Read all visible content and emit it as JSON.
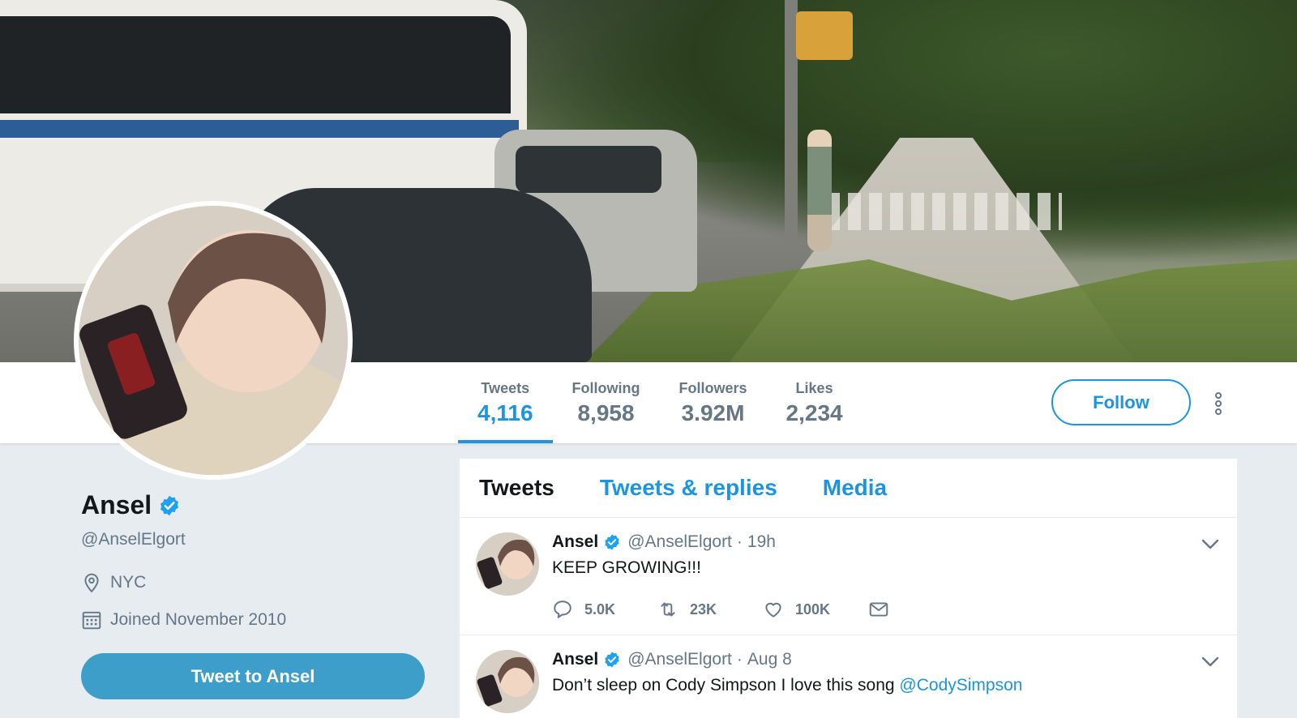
{
  "profile": {
    "name": "Ansel",
    "handle": "@AnselElgort",
    "location": "NYC",
    "joined": "Joined November 2010",
    "tweet_to_label": "Tweet to Ansel",
    "verified": true
  },
  "stats": [
    {
      "label": "Tweets",
      "value": "4,116",
      "active": true
    },
    {
      "label": "Following",
      "value": "8,958",
      "active": false
    },
    {
      "label": "Followers",
      "value": "3.92M",
      "active": false
    },
    {
      "label": "Likes",
      "value": "2,234",
      "active": false
    }
  ],
  "nav": {
    "follow_label": "Follow"
  },
  "timeline": {
    "tabs": [
      {
        "label": "Tweets",
        "active": true
      },
      {
        "label": "Tweets & replies",
        "active": false
      },
      {
        "label": "Media",
        "active": false
      }
    ],
    "tweets": [
      {
        "name": "Ansel",
        "handle": "@AnselElgort",
        "dot": "·",
        "time": "19h",
        "text": "KEEP GROWING!!!",
        "replies": "5.0K",
        "retweets": "23K",
        "likes": "100K"
      },
      {
        "name": "Ansel",
        "handle": "@AnselElgort",
        "dot": "·",
        "time": "Aug 8",
        "text": "Don’t sleep on Cody Simpson I love this song ",
        "mention": "@CodySimpson"
      }
    ]
  },
  "colors": {
    "accent": "#1b95e0",
    "muted": "#657786",
    "background": "#e6ecf0",
    "verified": "#1da1f2"
  },
  "icons": [
    "verified-badge-icon",
    "location-pin-icon",
    "calendar-icon",
    "more-vertical-icon",
    "chevron-down-icon",
    "reply-icon",
    "retweet-icon",
    "like-icon",
    "message-icon"
  ]
}
